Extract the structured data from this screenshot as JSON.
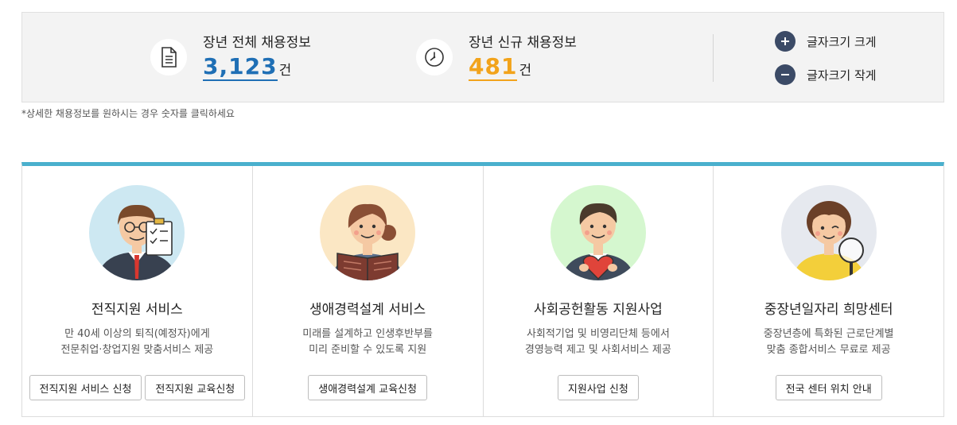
{
  "stats": {
    "total": {
      "label": "장년 전체 채용정보",
      "value": "3,123",
      "unit": "건",
      "icon": "document-icon",
      "color": "#1f6fb5"
    },
    "new": {
      "label": "장년 신규 채용정보",
      "value": "481",
      "unit": "건",
      "icon": "clock-icon",
      "color": "#f2a31b"
    }
  },
  "font_controls": {
    "increase_label": "글자크기 크게",
    "decrease_label": "글자크기 작게"
  },
  "notice": "*상세한 채용정보를 원하시는 경우 숫자를 클릭하세요",
  "accent_color": "#4ab0cd",
  "cards": [
    {
      "title": "전직지원 서비스",
      "desc": [
        "만 40세 이상의 퇴직(예정자)에게",
        "전문취업·창업지원 맞춤서비스 제공"
      ],
      "buttons": [
        "전직지원 서비스 신청",
        "전직지원 교육신청"
      ],
      "avatar_bg": "#cde8f2"
    },
    {
      "title": "생애경력설계 서비스",
      "desc": [
        "미래를 설계하고 인생후반부를",
        "미리 준비할 수 있도록 지원"
      ],
      "buttons": [
        "생애경력설계 교육신청"
      ],
      "avatar_bg": "#fbe7c4"
    },
    {
      "title": "사회공헌활동 지원사업",
      "desc": [
        "사회적기업 및 비영리단체 등에서",
        "경영능력 제고 및 사회서비스 제공"
      ],
      "buttons": [
        "지원사업 신청"
      ],
      "avatar_bg": "#d5f7cf"
    },
    {
      "title": "중장년일자리 희망센터",
      "desc": [
        "중장년층에 특화된 근로단계별",
        "맞춤 종합서비스 무료로 제공"
      ],
      "buttons": [
        "전국 센터 위치 안내"
      ],
      "avatar_bg": "#e6e9ef"
    }
  ]
}
